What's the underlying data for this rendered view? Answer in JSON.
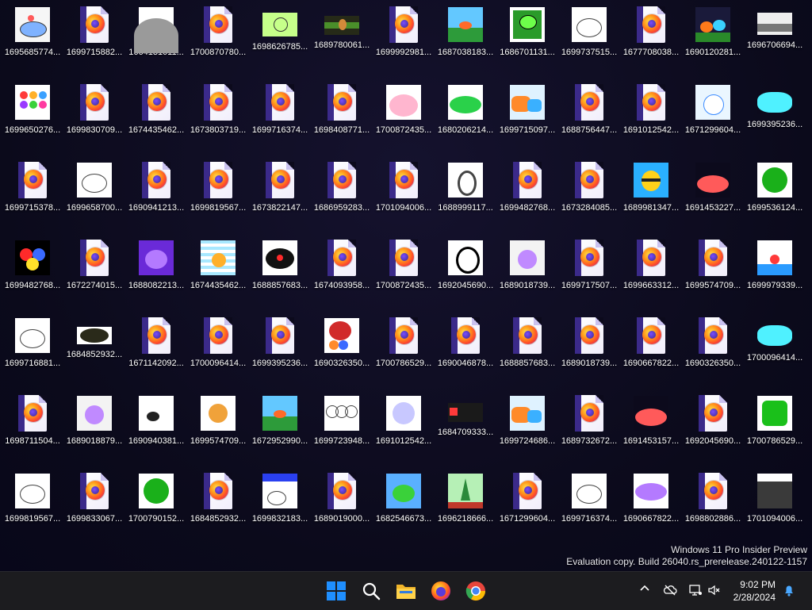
{
  "desktop": {
    "icons": [
      {
        "label": "1695685774...",
        "kind": "image",
        "thumb": "sky-blob"
      },
      {
        "label": "1699715882...",
        "kind": "firefox"
      },
      {
        "label": "1664131611...",
        "kind": "image",
        "thumb": "gray"
      },
      {
        "label": "1700870780...",
        "kind": "firefox"
      },
      {
        "label": "1698626785...",
        "kind": "image",
        "thumb": "green"
      },
      {
        "label": "1689780061...",
        "kind": "image",
        "thumb": "scene"
      },
      {
        "label": "1699992981...",
        "kind": "firefox"
      },
      {
        "label": "1687038183...",
        "kind": "image",
        "thumb": "landscape"
      },
      {
        "label": "1686701131...",
        "kind": "image",
        "thumb": "green-square"
      },
      {
        "label": "1699737515...",
        "kind": "image",
        "thumb": "sketch"
      },
      {
        "label": "1677708038...",
        "kind": "firefox"
      },
      {
        "label": "1690120281...",
        "kind": "image",
        "thumb": "game"
      },
      {
        "label": "1696706694...",
        "kind": "image",
        "thumb": "road"
      },
      {
        "label": "1699650276...",
        "kind": "image",
        "thumb": "dots"
      },
      {
        "label": "1699830709...",
        "kind": "firefox"
      },
      {
        "label": "1674435462...",
        "kind": "firefox"
      },
      {
        "label": "1673803719...",
        "kind": "firefox"
      },
      {
        "label": "1699716374...",
        "kind": "firefox"
      },
      {
        "label": "1698408771...",
        "kind": "firefox"
      },
      {
        "label": "1700872435...",
        "kind": "image",
        "thumb": "pink"
      },
      {
        "label": "1680206214...",
        "kind": "image",
        "thumb": "caterpillar"
      },
      {
        "label": "1699715097...",
        "kind": "image",
        "thumb": "orange-blob"
      },
      {
        "label": "1688756447...",
        "kind": "firefox"
      },
      {
        "label": "1691012542...",
        "kind": "firefox"
      },
      {
        "label": "1671299604...",
        "kind": "image",
        "thumb": "cat"
      },
      {
        "label": "1699395236...",
        "kind": "image",
        "thumb": "cyan"
      },
      {
        "label": "1699715378...",
        "kind": "firefox"
      },
      {
        "label": "1699658700...",
        "kind": "image",
        "thumb": "sketch"
      },
      {
        "label": "1690941213...",
        "kind": "firefox"
      },
      {
        "label": "1699819567...",
        "kind": "firefox"
      },
      {
        "label": "1673822147...",
        "kind": "firefox"
      },
      {
        "label": "1686959283...",
        "kind": "firefox"
      },
      {
        "label": "1701094006...",
        "kind": "firefox"
      },
      {
        "label": "1688999117...",
        "kind": "image",
        "thumb": "snake"
      },
      {
        "label": "1699482768...",
        "kind": "firefox"
      },
      {
        "label": "1673284085...",
        "kind": "firefox"
      },
      {
        "label": "1689981347...",
        "kind": "image",
        "thumb": "bee"
      },
      {
        "label": "1691453227...",
        "kind": "image",
        "thumb": "red-blob"
      },
      {
        "label": "1699536124...",
        "kind": "image",
        "thumb": "green-circle"
      },
      {
        "label": "1699482768...",
        "kind": "image",
        "thumb": "balls"
      },
      {
        "label": "1672274015...",
        "kind": "firefox"
      },
      {
        "label": "1688082213...",
        "kind": "image",
        "thumb": "purple"
      },
      {
        "label": "1674435462...",
        "kind": "image",
        "thumb": "stripes"
      },
      {
        "label": "1688857683...",
        "kind": "image",
        "thumb": "black"
      },
      {
        "label": "1674093958...",
        "kind": "firefox"
      },
      {
        "label": "1700872435...",
        "kind": "firefox"
      },
      {
        "label": "1692045690...",
        "kind": "image",
        "thumb": "face"
      },
      {
        "label": "1689018739...",
        "kind": "image",
        "thumb": "purple-char"
      },
      {
        "label": "1699717507...",
        "kind": "firefox"
      },
      {
        "label": "1699663312...",
        "kind": "firefox"
      },
      {
        "label": "1699574709...",
        "kind": "firefox"
      },
      {
        "label": "1699979339...",
        "kind": "image",
        "thumb": "flag"
      },
      {
        "label": "1699716881...",
        "kind": "image",
        "thumb": "sketch"
      },
      {
        "label": "1684852932...",
        "kind": "image",
        "thumb": "dark"
      },
      {
        "label": "1671142092...",
        "kind": "firefox"
      },
      {
        "label": "1700096414...",
        "kind": "firefox"
      },
      {
        "label": "1699395236...",
        "kind": "firefox"
      },
      {
        "label": "1690326350...",
        "kind": "image",
        "thumb": "red-bird"
      },
      {
        "label": "1700786529...",
        "kind": "firefox"
      },
      {
        "label": "1690046878...",
        "kind": "firefox"
      },
      {
        "label": "1688857683...",
        "kind": "firefox"
      },
      {
        "label": "1689018739...",
        "kind": "firefox"
      },
      {
        "label": "1690667822...",
        "kind": "firefox"
      },
      {
        "label": "1690326350...",
        "kind": "firefox"
      },
      {
        "label": "1700096414...",
        "kind": "image",
        "thumb": "cyan"
      },
      {
        "label": "1698711504...",
        "kind": "firefox"
      },
      {
        "label": "1689018879...",
        "kind": "image",
        "thumb": "purple-char"
      },
      {
        "label": "1690940381...",
        "kind": "image",
        "thumb": "white-scene"
      },
      {
        "label": "1699574709...",
        "kind": "image",
        "thumb": "orange-circle"
      },
      {
        "label": "1672952990...",
        "kind": "image",
        "thumb": "landscape"
      },
      {
        "label": "1699723948...",
        "kind": "image",
        "thumb": "clouds"
      },
      {
        "label": "1691012542...",
        "kind": "image",
        "thumb": "blue-glow"
      },
      {
        "label": "1684709333...",
        "kind": "image",
        "thumb": "dark-banner"
      },
      {
        "label": "1699724686...",
        "kind": "image",
        "thumb": "orange-blob"
      },
      {
        "label": "1689732672...",
        "kind": "firefox"
      },
      {
        "label": "1691453157...",
        "kind": "image",
        "thumb": "red-blob"
      },
      {
        "label": "1692045690...",
        "kind": "firefox"
      },
      {
        "label": "1700786529...",
        "kind": "image",
        "thumb": "green-shape"
      },
      {
        "label": "1699819567...",
        "kind": "image",
        "thumb": "sketch"
      },
      {
        "label": "1699833067...",
        "kind": "firefox"
      },
      {
        "label": "1700790152...",
        "kind": "image",
        "thumb": "green-circle"
      },
      {
        "label": "1684852932...",
        "kind": "firefox"
      },
      {
        "label": "1699832183...",
        "kind": "image",
        "thumb": "sketch-blue"
      },
      {
        "label": "1689019000...",
        "kind": "firefox"
      },
      {
        "label": "1682546673...",
        "kind": "image",
        "thumb": "frog"
      },
      {
        "label": "1696218666...",
        "kind": "image",
        "thumb": "tree"
      },
      {
        "label": "1671299604...",
        "kind": "firefox"
      },
      {
        "label": "1699716374...",
        "kind": "image",
        "thumb": "sketch"
      },
      {
        "label": "1690667822...",
        "kind": "image",
        "thumb": "purple-cloud"
      },
      {
        "label": "1698802886...",
        "kind": "firefox"
      },
      {
        "label": "1701094006...",
        "kind": "image",
        "thumb": "meme"
      }
    ]
  },
  "watermark": {
    "line1": "Windows 11 Pro Insider Preview",
    "line2": "Evaluation copy. Build 26040.rs_prerelease.240122-1157"
  },
  "taskbar": {
    "apps": [
      {
        "name": "start-button-icon"
      },
      {
        "name": "search-icon"
      },
      {
        "name": "file-explorer-icon"
      },
      {
        "name": "firefox-icon"
      },
      {
        "name": "chrome-icon"
      }
    ],
    "tray": {
      "time": "9:02 PM",
      "date": "2/28/2024"
    }
  },
  "colors": {
    "taskbar_bg": "#1c1c1f",
    "desktop_bg": "#0c0a1c",
    "firefox_purple": "#3b2a8a",
    "start_blue": "#1f8fff"
  }
}
